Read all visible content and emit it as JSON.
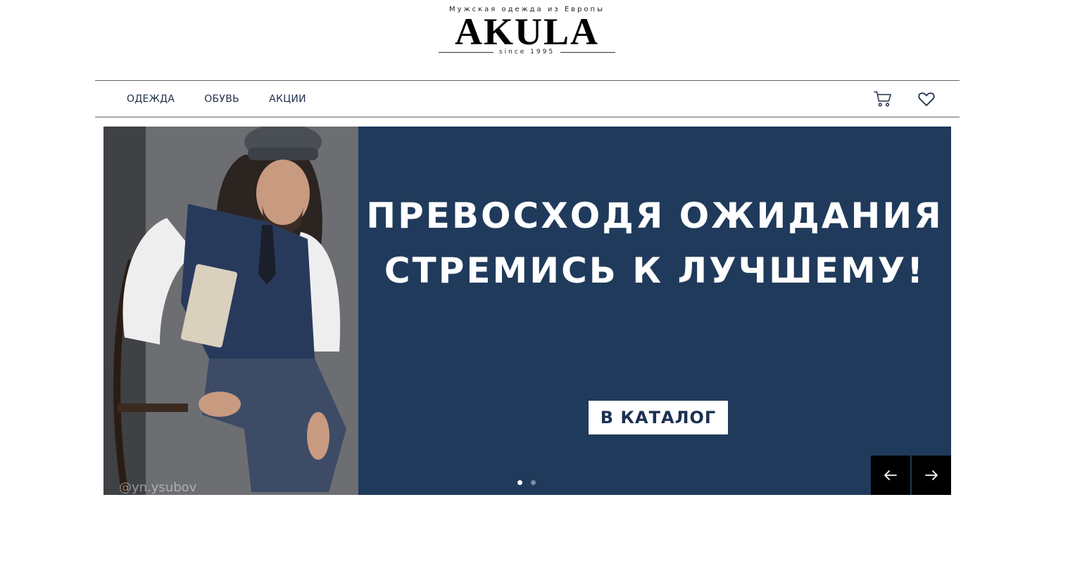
{
  "header": {
    "tagline": "Мужская одежда из Европы",
    "brand": "AKULA",
    "since": "since 1995"
  },
  "nav": {
    "links": [
      "ОДЕЖДА",
      "ОБУВЬ",
      "АКЦИИ"
    ],
    "icons": [
      "cart-icon",
      "heart-icon"
    ]
  },
  "hero": {
    "headline_line1": "ПРЕВОСХОДЯ ОЖИДАНИЯ",
    "headline_line2": "СТРЕМИСЬ К ЛУЧШЕМУ!",
    "cta_label": "В КАТАЛОГ",
    "watermark": "@yn.ysubov",
    "slides_total": 2,
    "active_slide": 1,
    "background_color": "#203a5b"
  },
  "carousel": {
    "prev_icon": "arrow-left-icon",
    "next_icon": "arrow-right-icon"
  }
}
